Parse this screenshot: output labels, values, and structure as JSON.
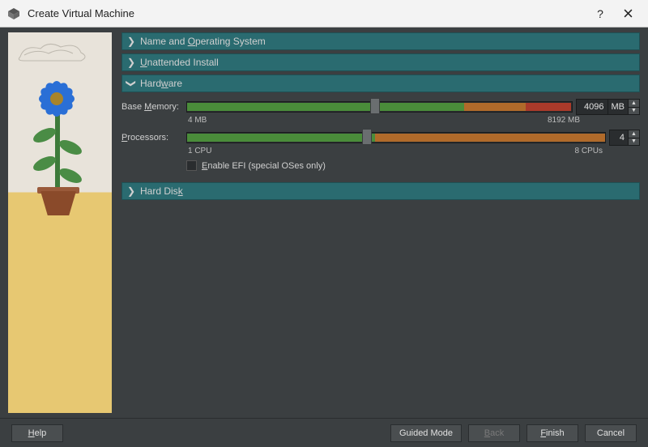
{
  "window": {
    "title": "Create Virtual Machine"
  },
  "sections": {
    "name_os": {
      "label": "Name and Operating System",
      "expanded": false
    },
    "unattended": {
      "label": "Unattended Install",
      "expanded": false
    },
    "hardware": {
      "label": "Hardware",
      "expanded": true
    },
    "hard_disk": {
      "label": "Hard Disk",
      "expanded": false
    }
  },
  "hardware": {
    "memory": {
      "label": "Base Memory:",
      "min_label": "4 MB",
      "max_label": "8192 MB",
      "value": "4096",
      "unit": "MB",
      "min": 4,
      "max": 8192,
      "green_end_pct": 72,
      "orange_end_pct": 88,
      "thumb_pct": 49
    },
    "cpu": {
      "label": "Processors:",
      "min_label": "1 CPU",
      "max_label": "8 CPUs",
      "value": "4",
      "min": 1,
      "max": 8,
      "green_end_pct": 45,
      "orange_end_pct": 100,
      "thumb_pct": 43
    },
    "efi": {
      "label": "Enable EFI (special OSes only)",
      "checked": false
    }
  },
  "footer": {
    "help": "Help",
    "guided": "Guided Mode",
    "back": "Back",
    "finish": "Finish",
    "cancel": "Cancel"
  }
}
